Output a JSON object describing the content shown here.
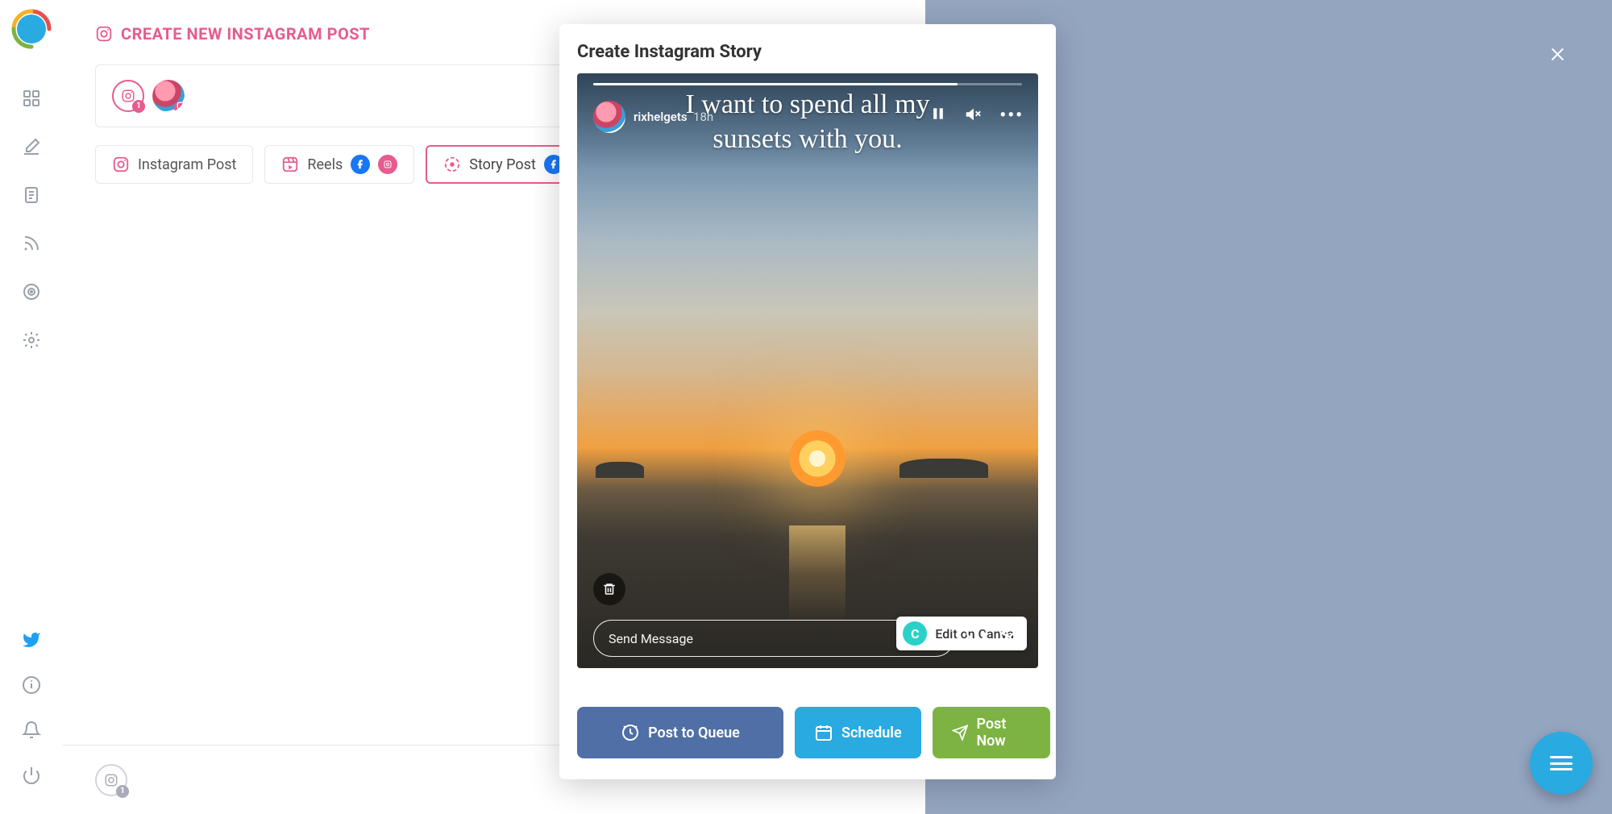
{
  "page": {
    "title": "CREATE NEW INSTAGRAM POST"
  },
  "accounts": {
    "selected_badge": "1"
  },
  "tabs": {
    "instagram_post": "Instagram Post",
    "reels": "Reels",
    "story_post": "Story Post"
  },
  "modal": {
    "title": "Create Instagram Story",
    "close": "×"
  },
  "story": {
    "username": "rixhelgets",
    "time_suffix": "18h",
    "caption_line1": "I want to spend all my",
    "caption_line2": "sunsets with you.",
    "send_placeholder": "Send Message",
    "edit_canva": "Edit on Canva",
    "canva_badge": "C"
  },
  "actions": {
    "queue": "Post to Queue",
    "schedule": "Schedule",
    "now": "Post Now"
  },
  "bottom": {
    "badge": "1"
  }
}
